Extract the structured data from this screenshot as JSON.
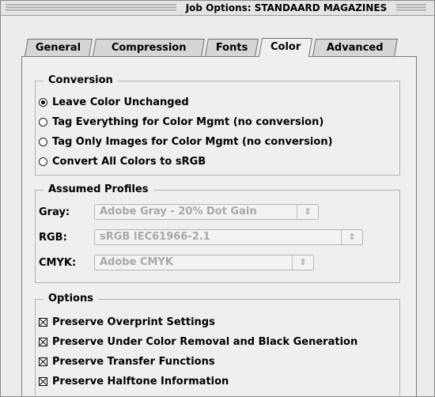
{
  "window": {
    "title": "Job Options: STANDAARD MAGAZINES"
  },
  "tabs": [
    {
      "label": "General",
      "active": false
    },
    {
      "label": "Compression",
      "active": false
    },
    {
      "label": "Fonts",
      "active": false
    },
    {
      "label": "Color",
      "active": true
    },
    {
      "label": "Advanced",
      "active": false
    }
  ],
  "conversion": {
    "title": "Conversion",
    "options": [
      {
        "label": "Leave Color Unchanged",
        "selected": true
      },
      {
        "label": "Tag Everything for Color Mgmt (no conversion)",
        "selected": false
      },
      {
        "label": "Tag Only Images for Color Mgmt (no conversion)",
        "selected": false
      },
      {
        "label": "Convert All Colors to sRGB",
        "selected": false
      }
    ]
  },
  "profiles": {
    "title": "Assumed Profiles",
    "gray": {
      "label": "Gray:",
      "value": "Adobe Gray - 20% Dot Gain"
    },
    "rgb": {
      "label": "RGB:",
      "value": "sRGB IEC61966-2.1"
    },
    "cmyk": {
      "label": "CMYK:",
      "value": "Adobe CMYK"
    },
    "arrow_glyph": "⇕"
  },
  "options": {
    "title": "Options",
    "checks": [
      {
        "label": "Preserve Overprint Settings",
        "checked": true
      },
      {
        "label": "Preserve Under Color Removal and Black Generation",
        "checked": true
      },
      {
        "label": "Preserve Transfer Functions",
        "checked": true
      },
      {
        "label": "Preserve Halftone Information",
        "checked": true
      }
    ]
  }
}
